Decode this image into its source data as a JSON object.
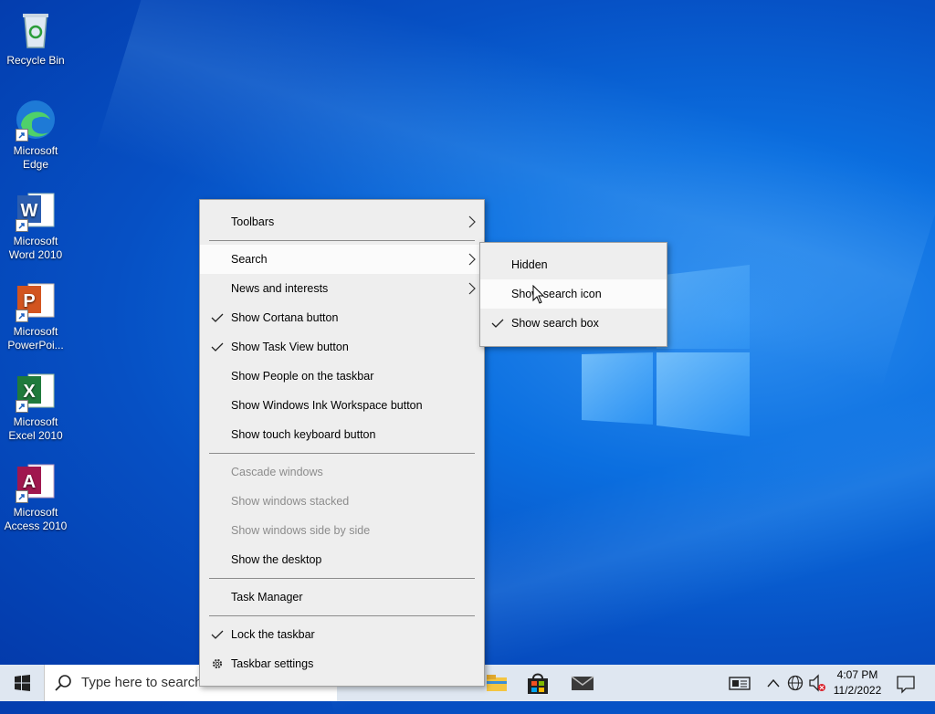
{
  "desktop": {
    "icons": [
      {
        "label": "Recycle Bin",
        "icon": "recycle-bin-icon"
      },
      {
        "label": "Microsoft Edge",
        "icon": "edge-icon"
      },
      {
        "label": "Microsoft Word 2010",
        "icon": "word-icon"
      },
      {
        "label": "Microsoft PowerPoi...",
        "icon": "powerpoint-icon"
      },
      {
        "label": "Microsoft Excel 2010",
        "icon": "excel-icon"
      },
      {
        "label": "Microsoft Access 2010",
        "icon": "access-icon"
      }
    ]
  },
  "context_menu": {
    "items": [
      {
        "label": "Toolbars",
        "submenu": true
      },
      {
        "label": "Search",
        "submenu": true,
        "highlighted": true
      },
      {
        "label": "News and interests",
        "submenu": true
      },
      {
        "label": "Show Cortana button",
        "checked": true
      },
      {
        "label": "Show Task View button",
        "checked": true
      },
      {
        "label": "Show People on the taskbar"
      },
      {
        "label": "Show Windows Ink Workspace button"
      },
      {
        "label": "Show touch keyboard button"
      },
      {
        "label": "Cascade windows",
        "disabled": true
      },
      {
        "label": "Show windows stacked",
        "disabled": true
      },
      {
        "label": "Show windows side by side",
        "disabled": true
      },
      {
        "label": "Show the desktop"
      },
      {
        "label": "Task Manager"
      },
      {
        "label": "Lock the taskbar",
        "checked": true
      },
      {
        "label": "Taskbar settings",
        "icon": "gear-icon"
      }
    ]
  },
  "search_submenu": {
    "items": [
      {
        "label": "Hidden"
      },
      {
        "label": "Show search icon",
        "highlighted": true
      },
      {
        "label": "Show search box",
        "checked": true
      }
    ]
  },
  "taskbar": {
    "search_placeholder": "Type here to search",
    "clock_time": "4:07 PM",
    "clock_date": "11/2/2022",
    "background": "#dfe7f1"
  },
  "colors": {
    "desktop_blue": "#0650c4",
    "menu_bg": "#eeeeee",
    "menu_highlight": "#fbfbfb",
    "disabled_text": "#8c8c8c"
  }
}
